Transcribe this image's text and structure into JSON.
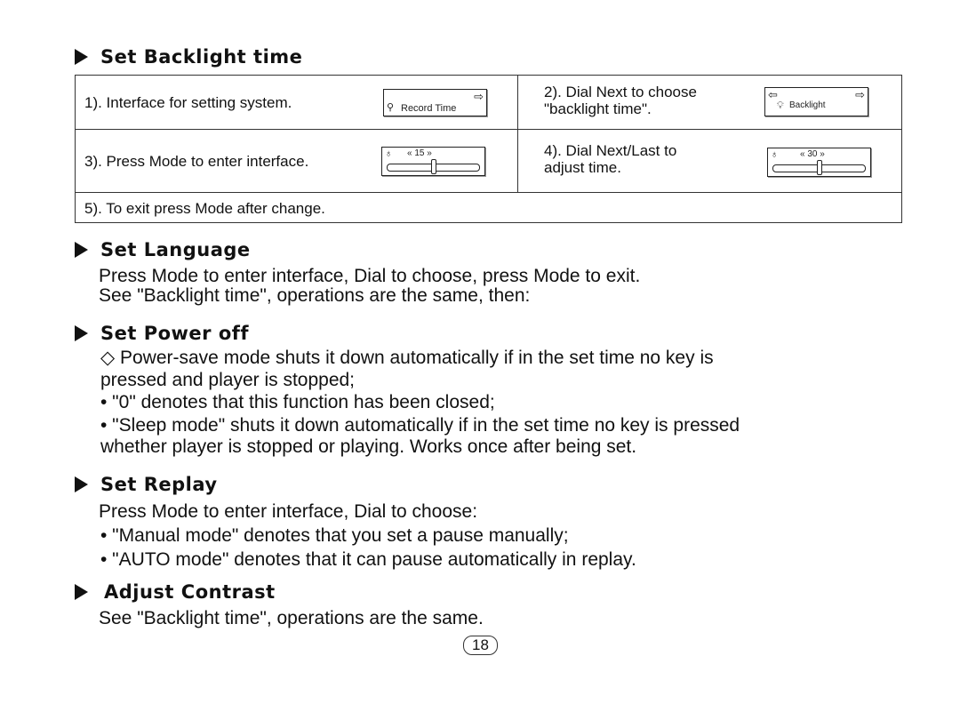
{
  "sections": {
    "backlight": {
      "title": "Set Backlight time",
      "steps": [
        {
          "text": "1). Interface for setting system.",
          "screen": {
            "icon": "record-icon",
            "label": "Record Time",
            "right_arrow": "⇨"
          }
        },
        {
          "text_lines": [
            "2). Dial Next to choose",
            "\"backlight time\"."
          ],
          "screen": {
            "icon": "bulb-icon",
            "label": "Backlight",
            "left_arrow": "⇦",
            "right_arrow": "⇨"
          }
        },
        {
          "text": "3). Press Mode to enter interface.",
          "screen": {
            "icon": "bulb-icon",
            "value": "15",
            "slider_fraction": 0.5,
            "left_chevron": "«",
            "right_chevron": "»"
          }
        },
        {
          "text_lines": [
            "4). Dial Next/Last to",
            "adjust time."
          ],
          "screen": {
            "icon": "bulb-icon",
            "value": "30",
            "slider_fraction": 0.5,
            "left_chevron": "«",
            "right_chevron": "»"
          }
        },
        {
          "text": "5). To exit press Mode after change."
        }
      ]
    },
    "language": {
      "title": "Set Language",
      "lines": [
        "Press Mode to enter interface, Dial to choose, press Mode to exit.",
        "See \"Backlight time\", operations are the same, then:"
      ]
    },
    "power_off": {
      "title": "Set Power off",
      "lines": [
        "◇ Power-save mode shuts it down automatically if in the set time no key is",
        "pressed and player is stopped;",
        "•  \"0\" denotes that this function has been closed;",
        "• \"Sleep mode\" shuts it down automatically if in the set time no key is pressed",
        "whether player is stopped or playing. Works once after being set."
      ]
    },
    "replay": {
      "title": "Set Replay",
      "lines": [
        "Press Mode to enter interface, Dial to choose:",
        "•  \"Manual mode\" denotes that you set a pause manually;",
        "•  \"AUTO mode\" denotes that it can pause automatically in replay."
      ]
    },
    "contrast": {
      "title": "Adjust Contrast",
      "lines": [
        "See \"Backlight time\", operations are the same."
      ]
    }
  },
  "page_number": "18"
}
